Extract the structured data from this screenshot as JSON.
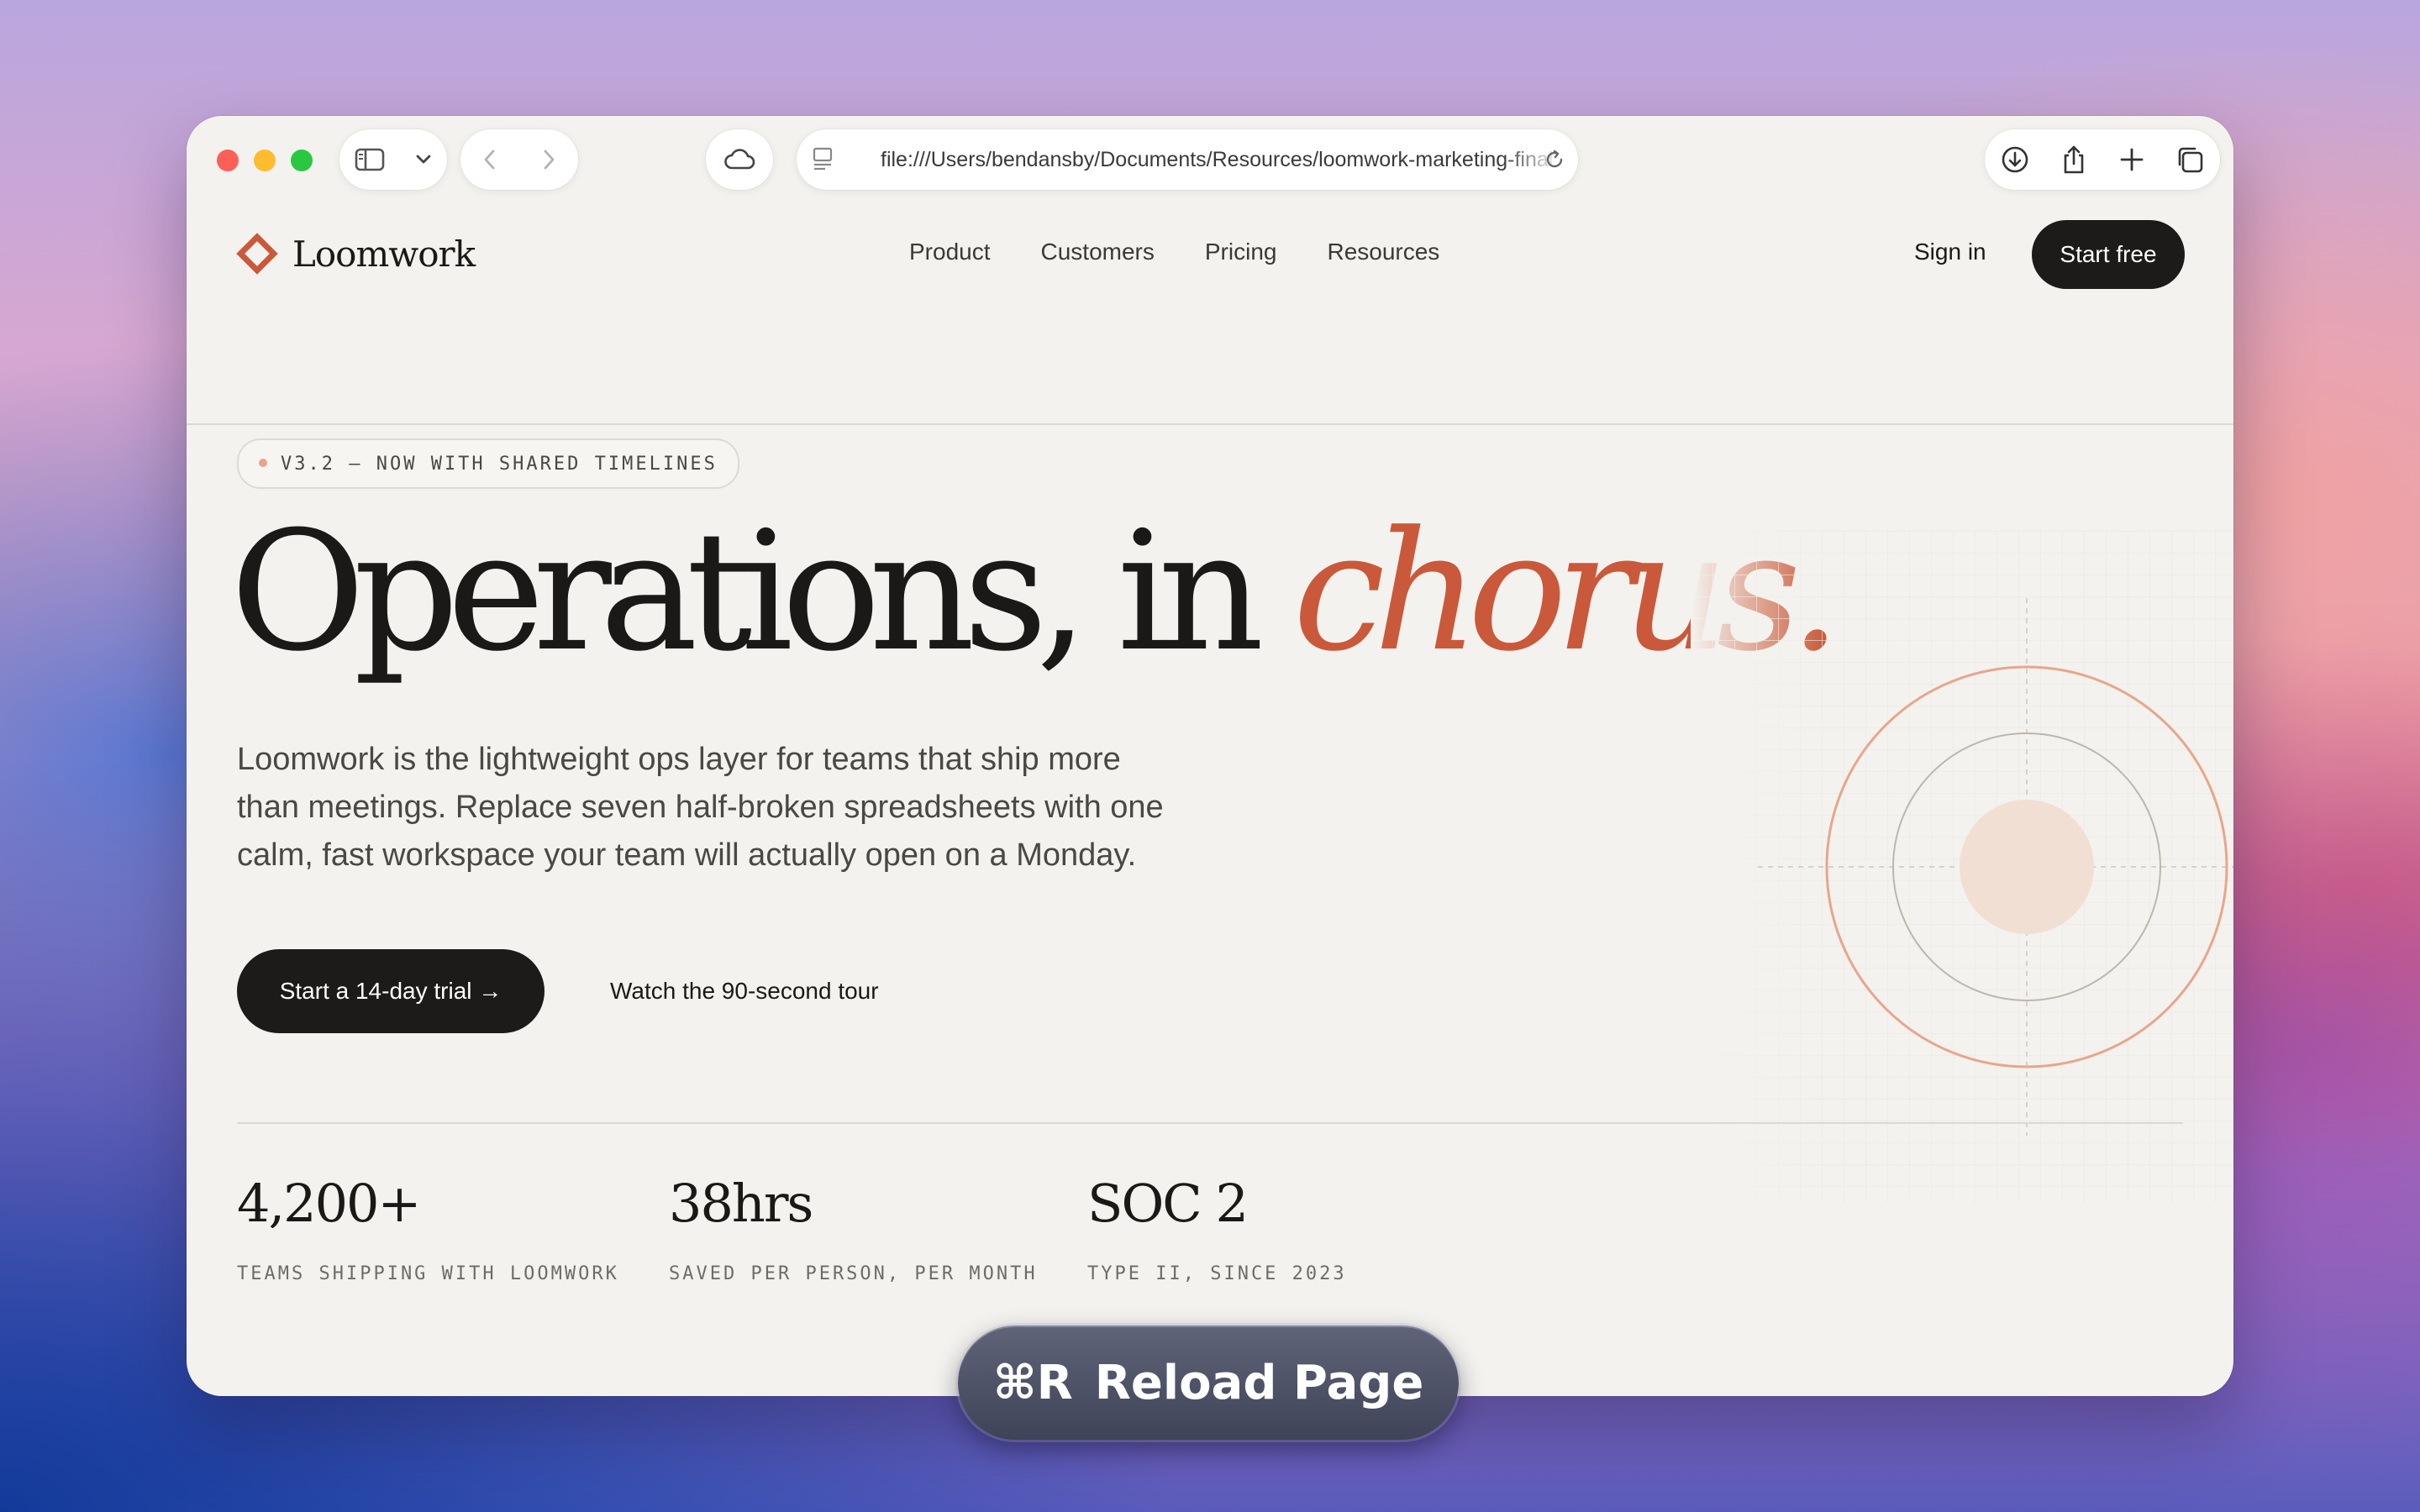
{
  "browser": {
    "url": "file:///Users/bendansby/Documents/Resources/loomwork-marketing-final.html"
  },
  "site": {
    "logo_text": "Loomwork",
    "nav": [
      "Product",
      "Customers",
      "Pricing",
      "Resources"
    ],
    "sign_in": "Sign in",
    "start_free": "Start free"
  },
  "hero": {
    "badge": "V3.2 — NOW WITH SHARED TIMELINES",
    "headline_main": "Operations, in ",
    "headline_accent": "chorus.",
    "subhead": "Loomwork is the lightweight ops layer for teams that ship more than meetings. Replace seven half-broken spreadsheets with one calm, fast workspace your team will actually open on a Monday.",
    "cta_primary": "Start a 14-day trial →",
    "cta_secondary": "Watch the 90-second tour"
  },
  "stats": [
    {
      "value": "4,200+",
      "label": "TEAMS SHIPPING WITH LOOMWORK"
    },
    {
      "value": "38hrs",
      "label": "SAVED PER PERSON, PER MONTH"
    },
    {
      "value": "SOC 2",
      "label": "TYPE II, SINCE 2023"
    }
  ],
  "hud": {
    "shortcut": "⌘R",
    "label": "Reload Page"
  },
  "colors": {
    "accent": "#c9593a",
    "ink": "#1a1917",
    "page_bg": "#f4f2ee"
  }
}
